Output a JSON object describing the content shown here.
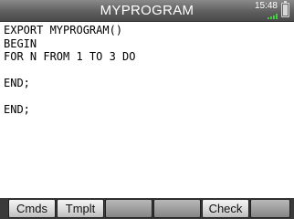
{
  "app": {
    "title": "MYPROGRAM",
    "clock": "15:48"
  },
  "editor": {
    "lines": [
      "EXPORT MYPROGRAM()",
      "BEGIN",
      "FOR N FROM 1 TO 3 DO",
      "",
      "END;",
      "",
      "END;"
    ]
  },
  "softkeys": [
    "Cmds",
    "Tmplt",
    "",
    "",
    "Check",
    ""
  ],
  "colors": {
    "titlebar": "#5f5f5f",
    "battery_signal": "#44cc44",
    "softkey_bar": "#3a3a3a"
  },
  "icons": [
    "battery-icon",
    "signal-icon"
  ]
}
